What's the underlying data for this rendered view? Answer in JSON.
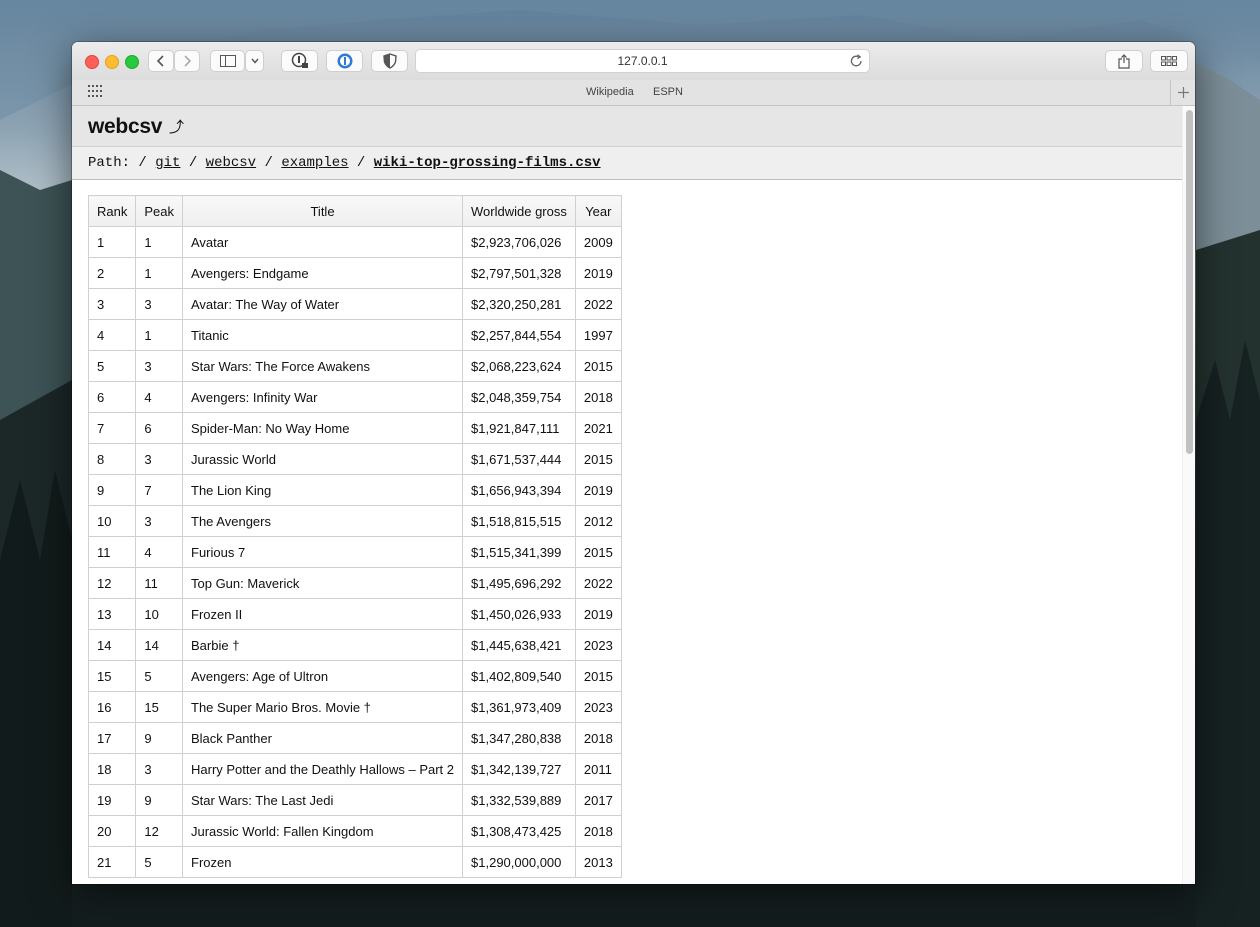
{
  "browser": {
    "url": "127.0.0.1",
    "favorites": [
      "Wikipedia",
      "ESPN"
    ]
  },
  "app": {
    "title": "webcsv",
    "title_icon": "external-arrow-icon"
  },
  "path": {
    "label": "Path:",
    "segments": [
      "git",
      "webcsv",
      "examples"
    ],
    "current": "wiki-top-grossing-films.csv"
  },
  "table": {
    "columns": [
      "Rank",
      "Peak",
      "Title",
      "Worldwide gross",
      "Year"
    ],
    "rows": [
      [
        "1",
        "1",
        "Avatar",
        "$2,923,706,026",
        "2009"
      ],
      [
        "2",
        "1",
        "Avengers: Endgame",
        "$2,797,501,328",
        "2019"
      ],
      [
        "3",
        "3",
        "Avatar: The Way of Water",
        "$2,320,250,281",
        "2022"
      ],
      [
        "4",
        "1",
        "Titanic",
        "$2,257,844,554",
        "1997"
      ],
      [
        "5",
        "3",
        "Star Wars: The Force Awakens",
        "$2,068,223,624",
        "2015"
      ],
      [
        "6",
        "4",
        "Avengers: Infinity War",
        "$2,048,359,754",
        "2018"
      ],
      [
        "7",
        "6",
        "Spider-Man: No Way Home",
        "$1,921,847,111",
        "2021"
      ],
      [
        "8",
        "3",
        "Jurassic World",
        "$1,671,537,444",
        "2015"
      ],
      [
        "9",
        "7",
        "The Lion King",
        "$1,656,943,394",
        "2019"
      ],
      [
        "10",
        "3",
        "The Avengers",
        "$1,518,815,515",
        "2012"
      ],
      [
        "11",
        "4",
        "Furious 7",
        "$1,515,341,399",
        "2015"
      ],
      [
        "12",
        "11",
        "Top Gun: Maverick",
        "$1,495,696,292",
        "2022"
      ],
      [
        "13",
        "10",
        "Frozen II",
        "$1,450,026,933",
        "2019"
      ],
      [
        "14",
        "14",
        "Barbie †",
        "$1,445,638,421",
        "2023"
      ],
      [
        "15",
        "5",
        "Avengers: Age of Ultron",
        "$1,402,809,540",
        "2015"
      ],
      [
        "16",
        "15",
        "The Super Mario Bros. Movie †",
        "$1,361,973,409",
        "2023"
      ],
      [
        "17",
        "9",
        "Black Panther",
        "$1,347,280,838",
        "2018"
      ],
      [
        "18",
        "3",
        "Harry Potter and the Deathly Hallows – Part 2",
        "$1,342,139,727",
        "2011"
      ],
      [
        "19",
        "9",
        "Star Wars: The Last Jedi",
        "$1,332,539,889",
        "2017"
      ],
      [
        "20",
        "12",
        "Jurassic World: Fallen Kingdom",
        "$1,308,473,425",
        "2018"
      ],
      [
        "21",
        "5",
        "Frozen",
        "$1,290,000,000",
        "2013"
      ]
    ]
  }
}
